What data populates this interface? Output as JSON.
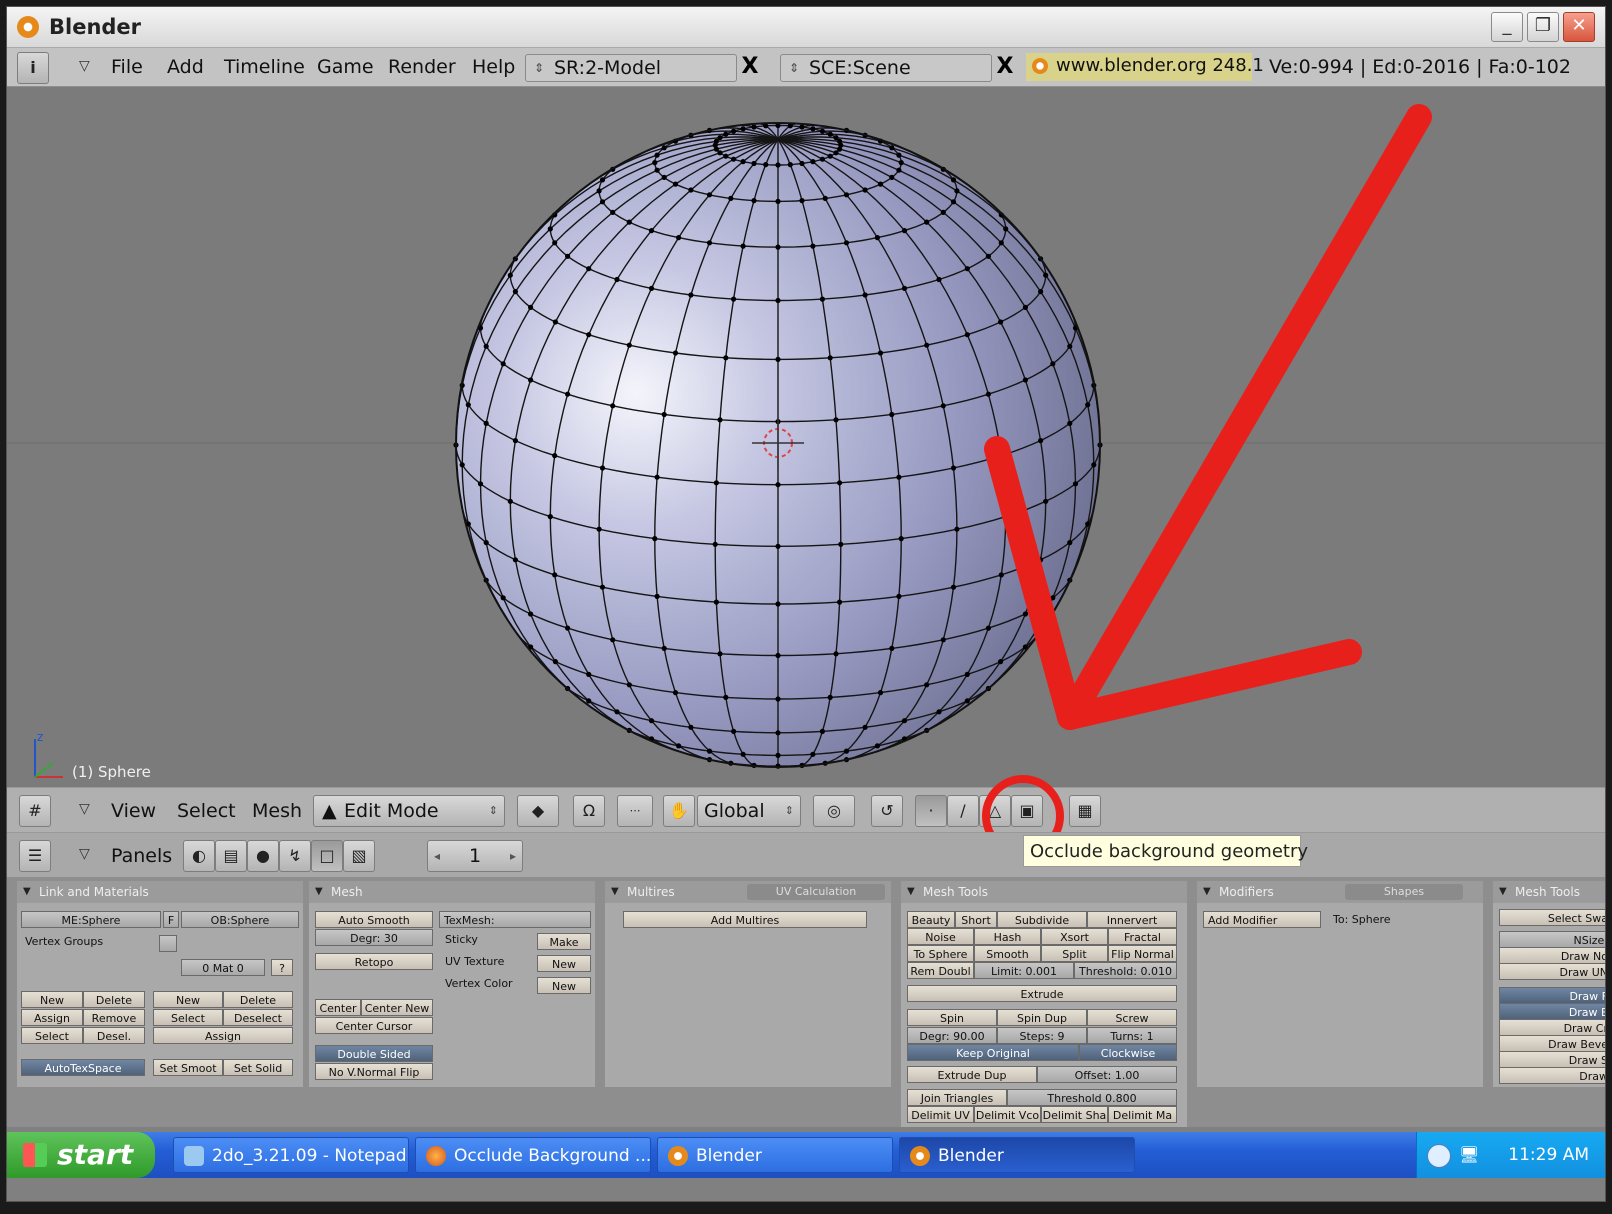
{
  "window": {
    "title": "Blender",
    "controls": [
      "_",
      "❐",
      "✕"
    ]
  },
  "menubar": {
    "info_icon": "info-icon",
    "items": [
      "File",
      "Add",
      "Timeline",
      "Game",
      "Render",
      "Help"
    ],
    "screen_field": "SR:2-Model",
    "scene_field": "SCE:Scene",
    "close_x": "X",
    "version": "www.blender.org 248.1",
    "stats": "Ve:0-994 | Ed:0-2016 | Fa:0-102"
  },
  "viewport": {
    "object_label": "(1) Sphere",
    "axis_label": "z"
  },
  "view_header": {
    "items": [
      "View",
      "Select",
      "Mesh"
    ],
    "mode": "Edit Mode",
    "orientation": "Global"
  },
  "buttons_header": {
    "panels_label": "Panels",
    "frame": "1"
  },
  "tooltip": "Occlude background geometry",
  "panels": {
    "link": {
      "title": "Link and Materials",
      "me": "ME:Sphere",
      "f": "F",
      "ob": "OB:Sphere",
      "vertex_groups": "Vertex Groups",
      "mat": "0 Mat 0",
      "q": "?",
      "new1": "New",
      "delete1": "Delete",
      "assign1": "Assign",
      "remove": "Remove",
      "select1": "Select",
      "desel": "Desel.",
      "new2": "New",
      "delete2": "Delete",
      "select2": "Select",
      "deselect": "Deselect",
      "assign2": "Assign",
      "autotex": "AutoTexSpace",
      "set_smoot": "Set Smoot",
      "set_solid": "Set Solid"
    },
    "mesh": {
      "title": "Mesh",
      "auto_smooth": "Auto Smooth",
      "degr": "Degr: 30",
      "retopo": "Retopo",
      "texmesh": "TexMesh:",
      "sticky": "Sticky",
      "make": "Make",
      "uv_texture": "UV Texture",
      "new_uv": "New",
      "vertex_color": "Vertex Color",
      "new_vc": "New",
      "center": "Center",
      "center_new": "Center New",
      "center_cursor": "Center Cursor",
      "double_sided": "Double Sided",
      "no_vnormal_flip": "No V.Normal Flip"
    },
    "multires": {
      "title": "Multires",
      "tab2": "UV Calculation",
      "add": "Add Multires"
    },
    "mesh_tools": {
      "title": "Mesh Tools",
      "row1": [
        "Beauty",
        "Short",
        "Subdivide",
        "Innervert"
      ],
      "row2": [
        "Noise",
        "Hash",
        "Xsort",
        "Fractal"
      ],
      "row3": [
        "To Sphere",
        "Smooth",
        "Split",
        "Flip Normal"
      ],
      "rem_doubl": "Rem Doubl",
      "limit": "Limit: 0.001",
      "threshold": "Threshold: 0.010",
      "extrude": "Extrude",
      "spin": "Spin",
      "spin_dup": "Spin Dup",
      "screw": "Screw",
      "degr": "Degr: 90.00",
      "steps": "Steps: 9",
      "turns": "Turns: 1",
      "keep_original": "Keep Original",
      "clockwise": "Clockwise",
      "extrude_dup": "Extrude Dup",
      "offset": "Offset: 1.00",
      "join_triangles": "Join Triangles",
      "threshold2": "Threshold 0.800",
      "delimit": [
        "Delimit UV",
        "Delimit Vco",
        "Delimit Sha",
        "Delimit Ma"
      ]
    },
    "modifiers": {
      "title": "Modifiers",
      "tab2": "Shapes",
      "add": "Add Modifier",
      "to": "To: Sphere"
    },
    "mesh_tools_more": {
      "title": "Mesh Tools",
      "select_sw": "Select Swa",
      "nsize": "NSize:",
      "items": [
        "Draw No",
        "Draw UN",
        "Draw F",
        "Draw E",
        "Draw Cr",
        "Draw Beve",
        "Draw S",
        "Draw"
      ]
    }
  },
  "taskbar": {
    "start": "start",
    "tasks": [
      "2do_3.21.09 - Notepad",
      "Occlude Background ...",
      "Blender",
      "Blender"
    ],
    "clock": "11:29 AM"
  },
  "colors": {
    "annotation_red": "#e8201c",
    "viewport_bg": "#7b7b7b",
    "mesh_face": "#9da0c6"
  }
}
